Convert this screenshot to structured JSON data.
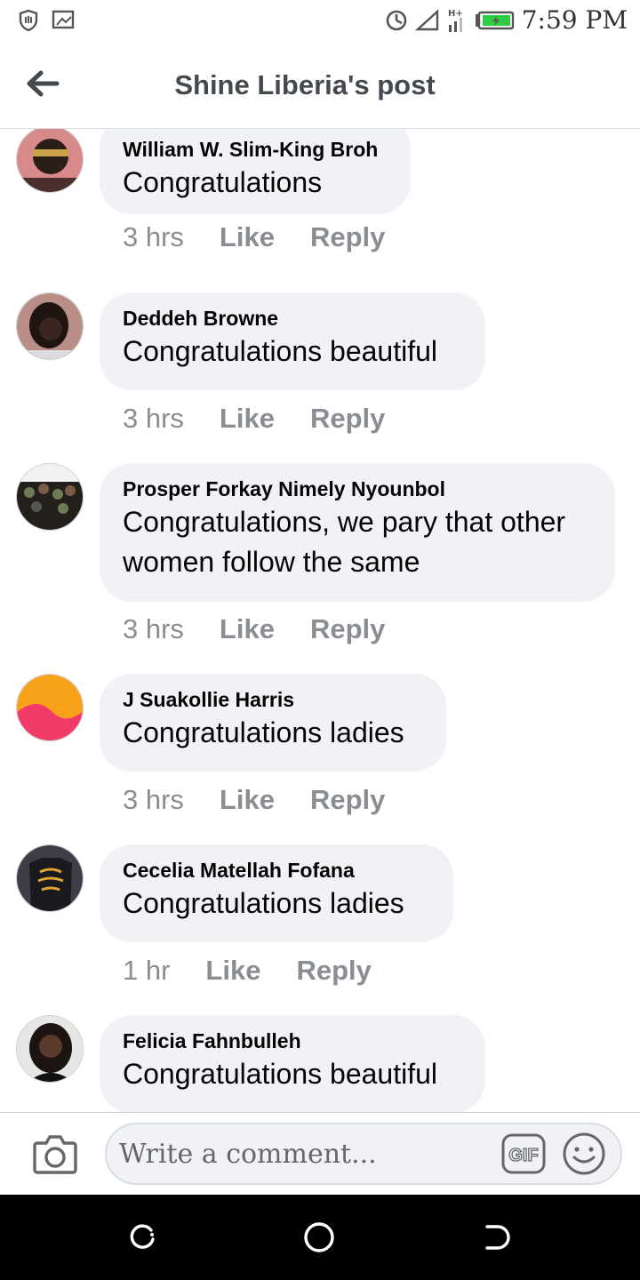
{
  "status_bar": {
    "time": "7:59 PM",
    "left_icons": [
      "shield-icon",
      "image-icon"
    ],
    "right_icons": [
      "data-saver-icon",
      "signal-icon",
      "network-type-icon",
      "battery-icon"
    ],
    "network_label": "H+"
  },
  "header": {
    "title": "Shine Liberia's post",
    "back_icon": "arrow-left-icon"
  },
  "comments": [
    {
      "author": "William W. Slim-King Broh",
      "text": [
        "Congratulations"
      ],
      "time": "3 hrs",
      "like": "Like",
      "reply": "Reply",
      "avatar_colors": [
        "#d88a8a",
        "#2b1d17"
      ]
    },
    {
      "author": "Deddeh Browne",
      "text": [
        "Congratulations beautiful"
      ],
      "time": "3 hrs",
      "like": "Like",
      "reply": "Reply",
      "avatar_colors": [
        "#b88e86",
        "#1f1410"
      ]
    },
    {
      "author": "Prosper Forkay Nimely Nyounbol",
      "text": [
        "Congratulations, we pary that other",
        "women follow the same"
      ],
      "time": "3 hrs",
      "like": "Like",
      "reply": "Reply",
      "avatar_colors": [
        "#6e7c55",
        "#23201c"
      ]
    },
    {
      "author": "J Suakollie Harris",
      "text": [
        "Congratulations ladies"
      ],
      "time": "3 hrs",
      "like": "Like",
      "reply": "Reply",
      "avatar_colors": [
        "#f7a21a",
        "#f23a68"
      ]
    },
    {
      "author": "Cecelia Matellah Fofana",
      "text": [
        "Congratulations ladies"
      ],
      "time": "1 hr",
      "like": "Like",
      "reply": "Reply",
      "avatar_colors": [
        "#3d3e46",
        "#e0a433"
      ]
    },
    {
      "author": "Felicia Fahnbulleh",
      "text": [
        "Congratulations beautiful"
      ],
      "time": "",
      "like": "",
      "reply": "",
      "avatar_colors": [
        "#e6e6e6",
        "#1c1411"
      ]
    }
  ],
  "composer": {
    "placeholder": "Write a comment...",
    "gif_label": "GIF",
    "camera_icon": "camera-icon",
    "emoji_icon": "smiley-icon"
  },
  "nav_bar": {
    "icons": [
      "recent-apps-icon",
      "home-icon",
      "back-icon"
    ]
  },
  "colors": {
    "bubble": "#f0f2f5",
    "meta_text": "#8a8d91",
    "header_title": "#444950",
    "battery_green": "#2ecc40"
  }
}
